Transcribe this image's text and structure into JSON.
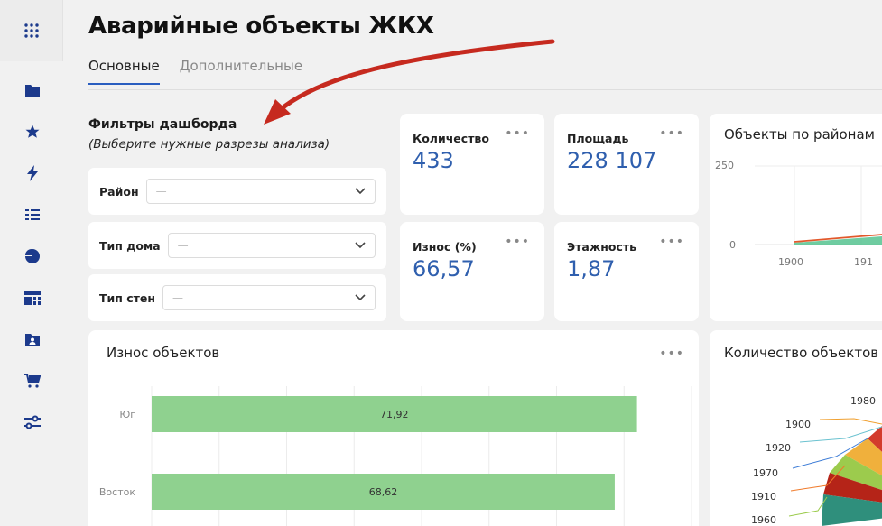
{
  "sidebar": {
    "icons": [
      "apps-grid-icon",
      "folder-icon",
      "star-icon",
      "lightning-icon",
      "list-icon",
      "pie-chart-icon",
      "dashboard-icon",
      "user-folder-icon",
      "cart-icon",
      "settings-sliders-icon"
    ]
  },
  "header": {
    "title": "Аварийные объекты ЖКХ",
    "tabs": [
      {
        "label": "Основные",
        "active": true
      },
      {
        "label": "Дополнительные",
        "active": false
      }
    ]
  },
  "filters": {
    "title": "Фильтры дашборда",
    "subtitle": "(Выберите нужные разрезы анализа)",
    "items": [
      {
        "label": "Район",
        "value": "—"
      },
      {
        "label": "Тип дома",
        "value": "—"
      },
      {
        "label": "Тип стен",
        "value": "—"
      }
    ]
  },
  "metrics": [
    {
      "label": "Количество",
      "value": "433"
    },
    {
      "label": "Площадь",
      "value": "228 107"
    },
    {
      "label": "Износ (%)",
      "value": "66,57"
    },
    {
      "label": "Этажность",
      "value": "1,87"
    }
  ],
  "districts_chart": {
    "title": "Объекты по районам",
    "y_ticks": [
      "250",
      "0"
    ],
    "x_ticks": [
      "1900",
      "191"
    ]
  },
  "wear_chart": {
    "title": "Износ объектов",
    "menu": "•••"
  },
  "count_chart": {
    "title": "Количество объектов",
    "labels": [
      "1980",
      "1900",
      "1920",
      "1970",
      "1910",
      "1960"
    ]
  },
  "chart_data": {
    "type": "bar",
    "title": "Износ объектов",
    "orientation": "horizontal",
    "categories": [
      "Юг",
      "Восток"
    ],
    "values": [
      71.92,
      68.62
    ],
    "value_labels": [
      "71,92",
      "68,62"
    ],
    "xlim": [
      0,
      80
    ],
    "grid": true,
    "bar_color": "#8fd18f"
  },
  "colors": {
    "accent": "#2f5fae",
    "arrow": "#c62a1f",
    "bar": "#8fd18f"
  }
}
